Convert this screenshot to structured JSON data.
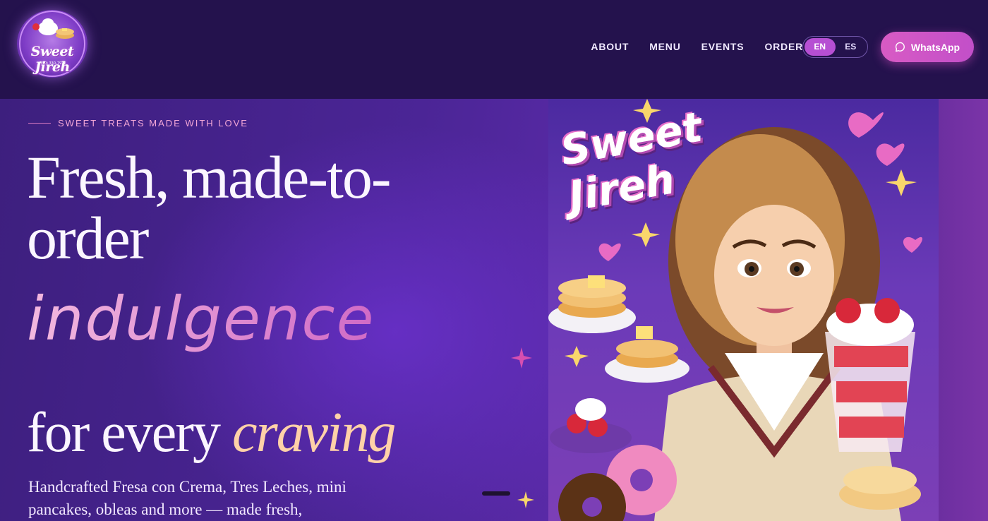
{
  "brand": {
    "logo_text": "Sweet Jireh",
    "logo_phone": "(330) 330-7972"
  },
  "nav": {
    "items": [
      "ABOUT",
      "MENU",
      "EVENTS",
      "ORDER"
    ]
  },
  "language": {
    "options": [
      "EN",
      "ES"
    ],
    "selected": "EN"
  },
  "whatsapp": {
    "label": "WhatsApp"
  },
  "hero": {
    "eyebrow": "SWEET TREATS MADE WITH LOVE",
    "headline_line1": "Fresh, made-to-",
    "headline_line2": "order",
    "headline_script": "indulgence",
    "headline_line3_plain": "for every",
    "headline_line3_accent": "craving",
    "description": "Handcrafted Fresa con Crema, Tres Leches, mini pancakes, obleas and more — made fresh,"
  },
  "illustration": {
    "title": "Sweet Jireh"
  },
  "colors": {
    "header_bg": "#24124d",
    "accent_pink": "#d85bc4",
    "eyebrow": "#f2a6d6",
    "script": "#e79bd6",
    "accent_peach": "#ffd1a8"
  },
  "icons": {
    "whatsapp": "chat-bubble-icon",
    "sparkle": "sparkle-icon",
    "heart": "heart-icon"
  }
}
